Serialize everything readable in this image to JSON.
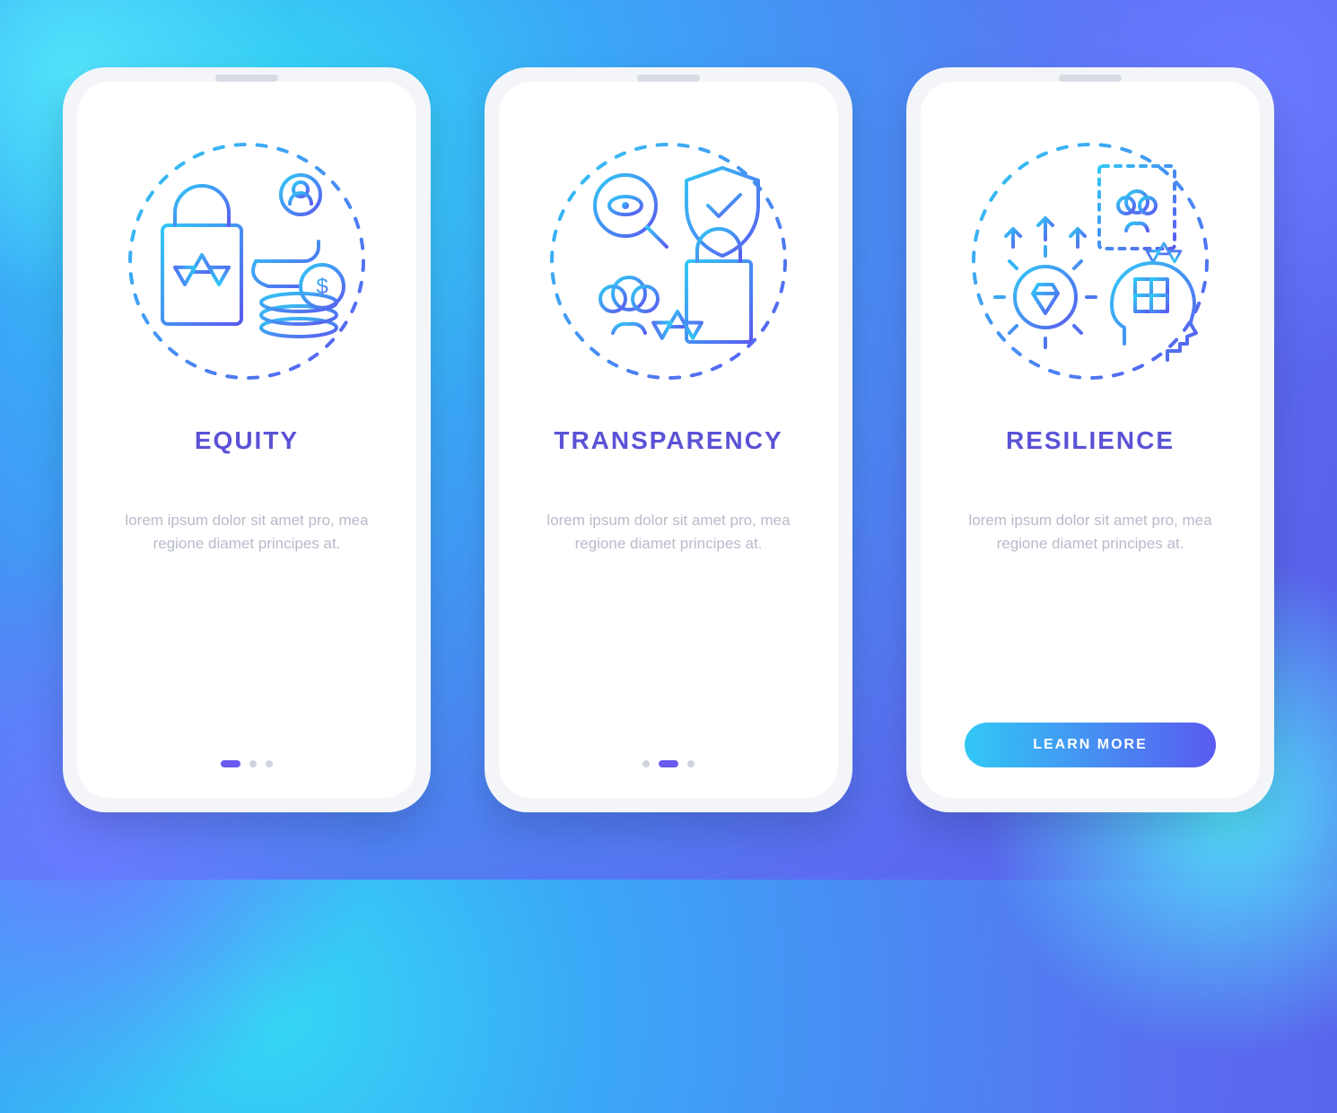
{
  "screens": [
    {
      "title": "EQUITY",
      "desc": "lorem ipsum dolor sit amet pro, mea regione diamet principes at.",
      "icon_name": "equity-icon",
      "pager_active_index": 0,
      "has_cta": false
    },
    {
      "title": "TRANSPARENCY",
      "desc": "lorem ipsum dolor sit amet pro, mea regione diamet principes at.",
      "icon_name": "transparency-icon",
      "pager_active_index": 1,
      "has_cta": false
    },
    {
      "title": "RESILIENCE",
      "desc": "lorem ipsum dolor sit amet pro, mea regione diamet principes at.",
      "icon_name": "resilience-icon",
      "pager_active_index": 2,
      "has_cta": true,
      "cta_label": "LEARN MORE"
    }
  ],
  "colors": {
    "title": "#5b52d6",
    "desc": "#b7bcc9",
    "grad_a": "#31c8f5",
    "grad_b": "#5a5af0"
  }
}
